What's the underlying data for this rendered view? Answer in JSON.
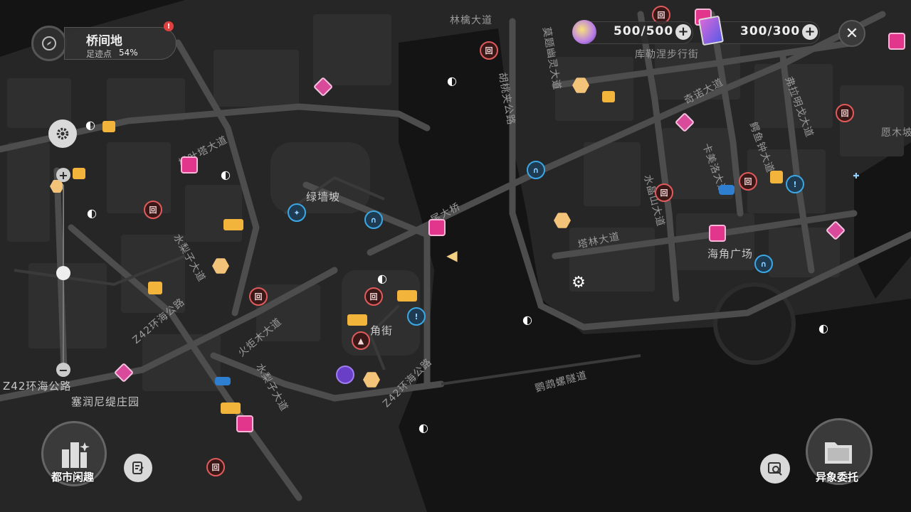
{
  "area": {
    "name": "桥间地",
    "progress_label": "足迹点",
    "progress_value": "54%",
    "alert_icon": "alert-icon"
  },
  "resources": [
    {
      "name": "battery",
      "icon": "energy-orb-icon",
      "value": "500/500"
    },
    {
      "name": "cards",
      "icon": "card-stack-icon",
      "value": "300/300"
    }
  ],
  "street_labels": {
    "linqin": "林檎大道",
    "motao": "莫题幽灵大道",
    "hutao": "胡桃夹公路",
    "kulei": "库勒涅步行街",
    "qinuo": "奇诺大道",
    "fula": "弗拉明戈大道",
    "yuanmu": "愿木坡",
    "shuye": "枫叶塔大道",
    "lvqiang": "绿墙坡",
    "wei": "尾大桥",
    "kamei": "卡美洛大道",
    "eyu": "鳄鱼钟大道",
    "shuijing": "水晶山大道",
    "talin": "塔林大道",
    "haijiao_square": "海角广场",
    "shuili": "水梨子大道",
    "z42_a": "Z42环海公路",
    "huoju": "火炬木大道",
    "jiao": "角街",
    "z42_b": "Z42环海公路",
    "shuili2": "水梨子大道",
    "yingwu": "鹦鹉螺隧道",
    "z42_c": "Z42环海公路",
    "sairun": "塞润尼缇庄园"
  },
  "buttons": {
    "city_fun": "都市闲趣",
    "anomaly": "异象委托"
  },
  "icons": {
    "compass": "compass-icon",
    "settings": "gear-icon",
    "zoom_in": "plus-icon",
    "zoom_out": "minus-icon",
    "close": "close-icon",
    "notes": "notes-icon",
    "search_map": "map-search-icon"
  },
  "zoom": {
    "level": 0.62
  },
  "colors": {
    "background": "#1b1b1b",
    "road": "#4a4a4a",
    "water": "#141414",
    "accent_pink": "#e2358c",
    "accent_red": "#e05b5b",
    "accent_gold": "#f2b43a",
    "accent_blue": "#3ba8e6"
  }
}
